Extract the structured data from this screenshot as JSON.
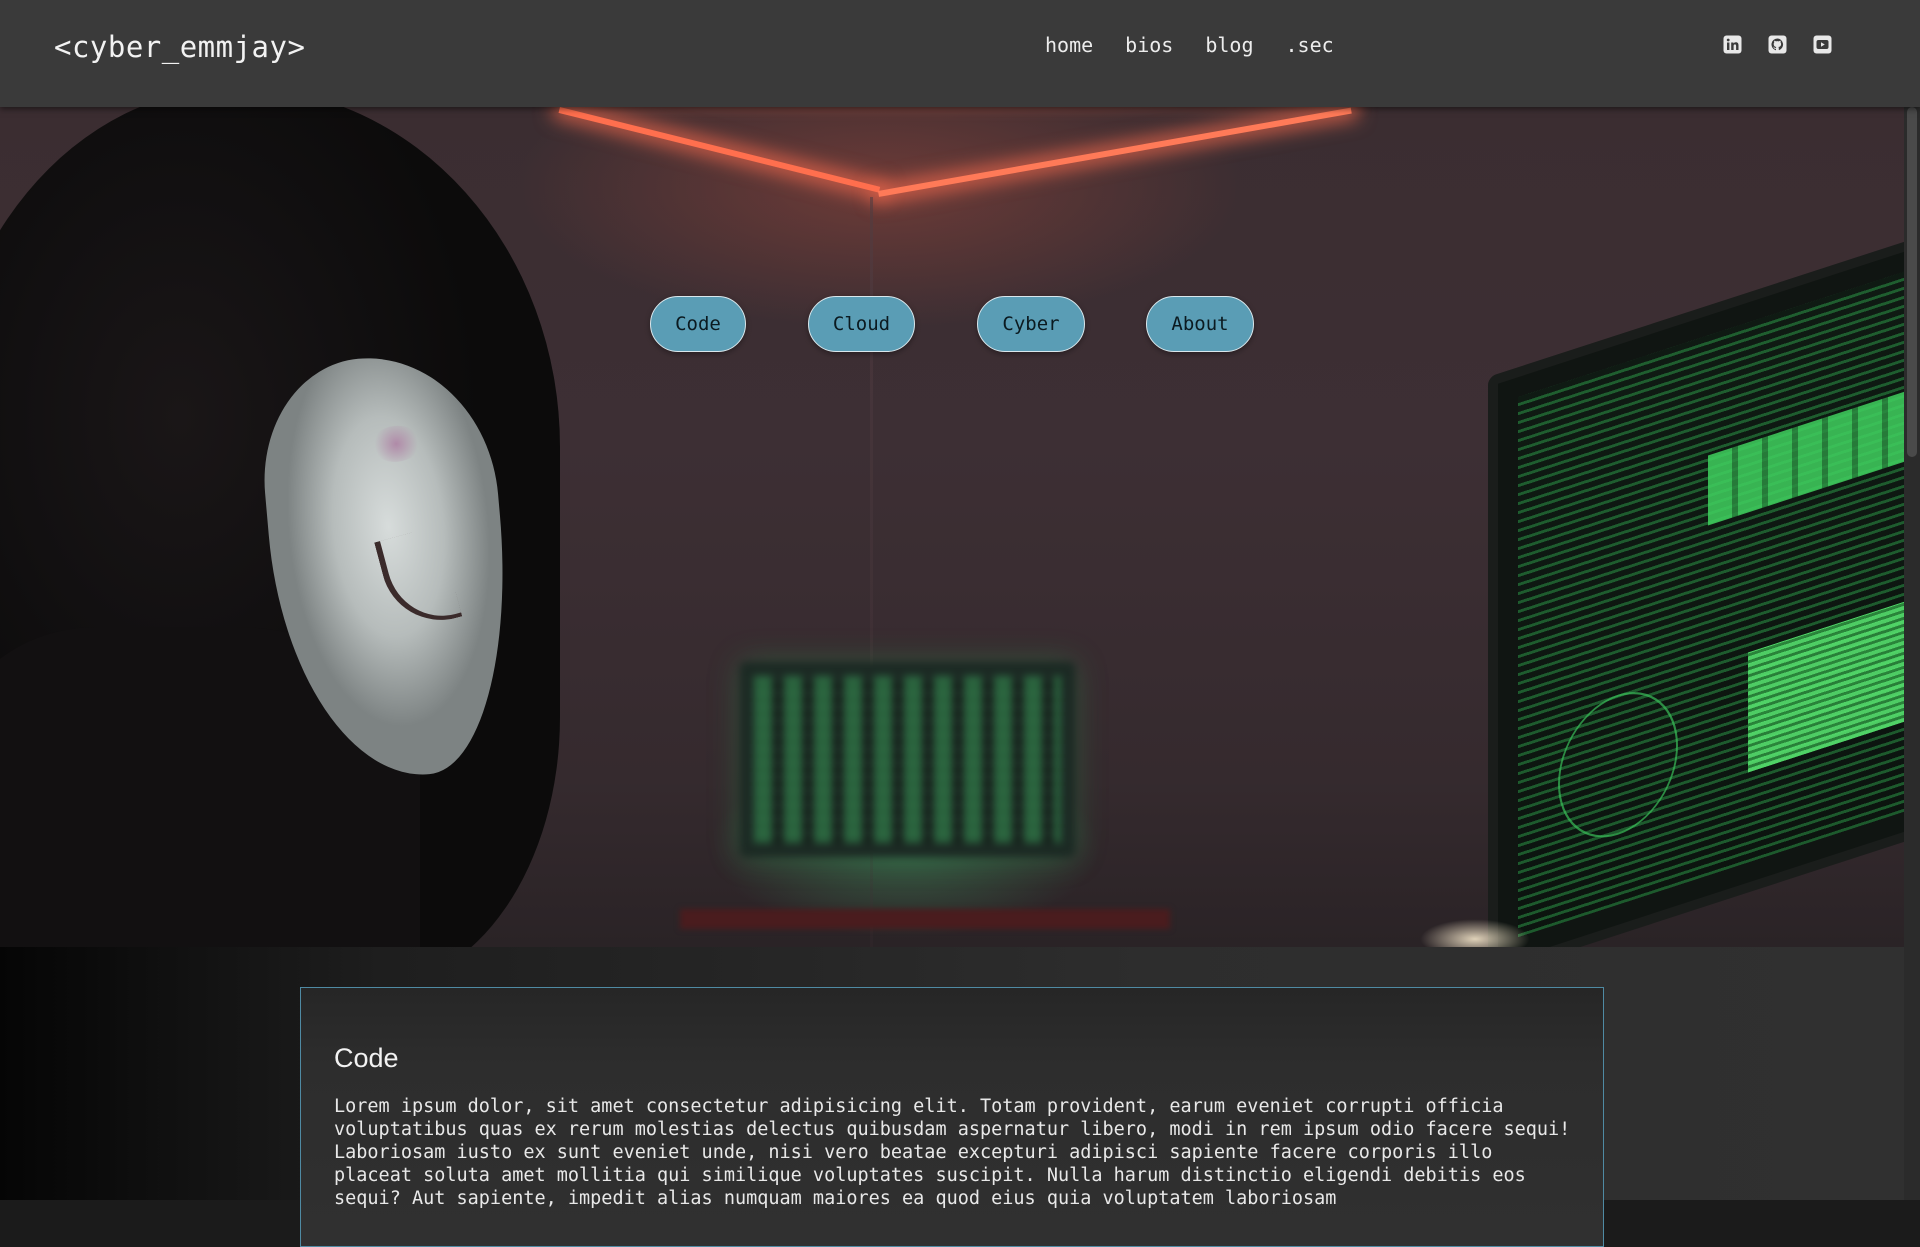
{
  "header": {
    "logo": "<cyber_emmjay>",
    "nav": [
      "home",
      "bios",
      "blog",
      ".sec"
    ],
    "socials": [
      {
        "name": "linkedin-icon"
      },
      {
        "name": "github-icon"
      },
      {
        "name": "youtube-icon"
      }
    ]
  },
  "hero": {
    "buttons": [
      "Code",
      "Cloud",
      "Cyber",
      "About"
    ],
    "button_color": "#5a9db5"
  },
  "section": {
    "title": "Code",
    "body": "Lorem ipsum dolor, sit amet consectetur adipisicing elit. Totam provident, earum eveniet corrupti officia voluptatibus quas ex rerum molestias delectus quibusdam aspernatur libero, modi in rem ipsum odio facere sequi! Laboriosam iusto ex sunt eveniet unde, nisi vero beatae excepturi adipisci sapiente facere corporis illo placeat soluta amet mollitia qui similique voluptates suscipit. Nulla harum distinctio eligendi debitis eos sequi? Aut sapiente, impedit alias numquam maiores ea quod eius quia voluptatem laboriosam",
    "border_color": "#4f8aa3"
  }
}
